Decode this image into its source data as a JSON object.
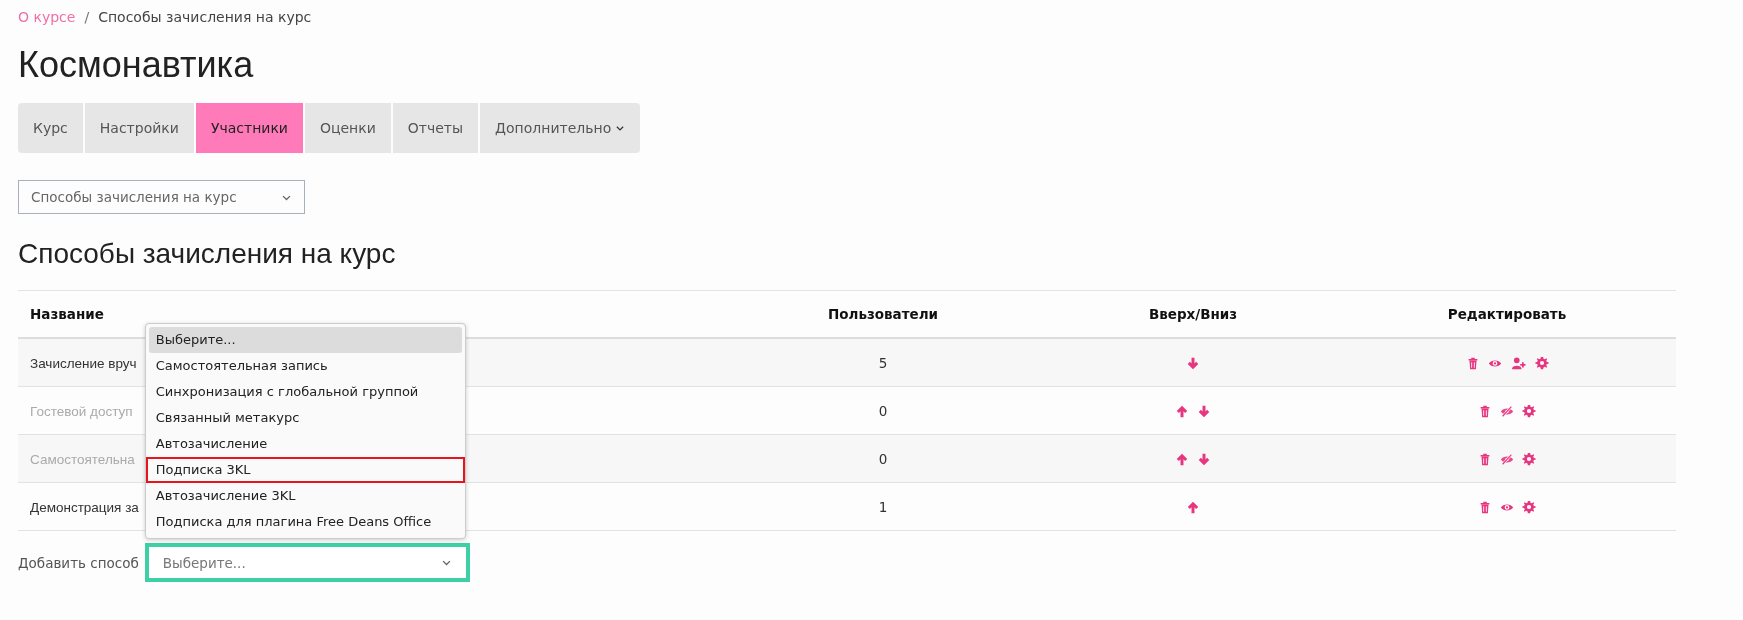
{
  "breadcrumb": [
    {
      "label": "О курсе",
      "link": true
    },
    {
      "label": "Способы зачисления на курс",
      "link": false
    }
  ],
  "breadcrumb_separator": "/",
  "page_title": "Космонавтика",
  "tabs": [
    {
      "label": "Курс",
      "selected": false,
      "dropdown": false
    },
    {
      "label": "Настройки",
      "selected": false,
      "dropdown": false
    },
    {
      "label": "Участники",
      "selected": true,
      "dropdown": false
    },
    {
      "label": "Оценки",
      "selected": false,
      "dropdown": false
    },
    {
      "label": "Отчеты",
      "selected": false,
      "dropdown": false
    },
    {
      "label": "Дополнительно",
      "selected": false,
      "dropdown": true
    }
  ],
  "page_select": {
    "value": "Способы зачисления на курс"
  },
  "section_title": "Способы зачисления на курс",
  "table": {
    "columns": [
      "Название",
      "Пользователи",
      "Вверх/Вниз",
      "Редактировать"
    ],
    "rows": [
      {
        "name": "Зачисление вруч",
        "disabled": false,
        "users": "5",
        "move_up": false,
        "move_down": true,
        "visible": true,
        "can_enrol": true
      },
      {
        "name": "Гостевой доступ",
        "disabled": true,
        "users": "0",
        "move_up": true,
        "move_down": true,
        "visible": false,
        "can_enrol": false
      },
      {
        "name": "Самостоятельна",
        "disabled": true,
        "users": "0",
        "move_up": true,
        "move_down": true,
        "visible": false,
        "can_enrol": false
      },
      {
        "name": "Демонстрация за",
        "disabled": false,
        "users": "1",
        "move_up": true,
        "move_down": false,
        "visible": true,
        "can_enrol": false
      }
    ]
  },
  "add_method": {
    "label": "Добавить способ",
    "placeholder": "Выберите...",
    "highlighted": true,
    "options": [
      {
        "label": "Выберите...",
        "selected": true,
        "highlighted": false
      },
      {
        "label": "Самостоятельная запись",
        "selected": false,
        "highlighted": false
      },
      {
        "label": "Синхронизация с глобальной группой",
        "selected": false,
        "highlighted": false
      },
      {
        "label": "Связанный метакурс",
        "selected": false,
        "highlighted": false
      },
      {
        "label": "Автозачисление",
        "selected": false,
        "highlighted": false
      },
      {
        "label": "Подписка 3KL",
        "selected": false,
        "highlighted": true
      },
      {
        "label": "Автозачисление 3KL",
        "selected": false,
        "highlighted": false
      },
      {
        "label": "Подписка для плагина Free Deans Office",
        "selected": false,
        "highlighted": false
      }
    ]
  }
}
